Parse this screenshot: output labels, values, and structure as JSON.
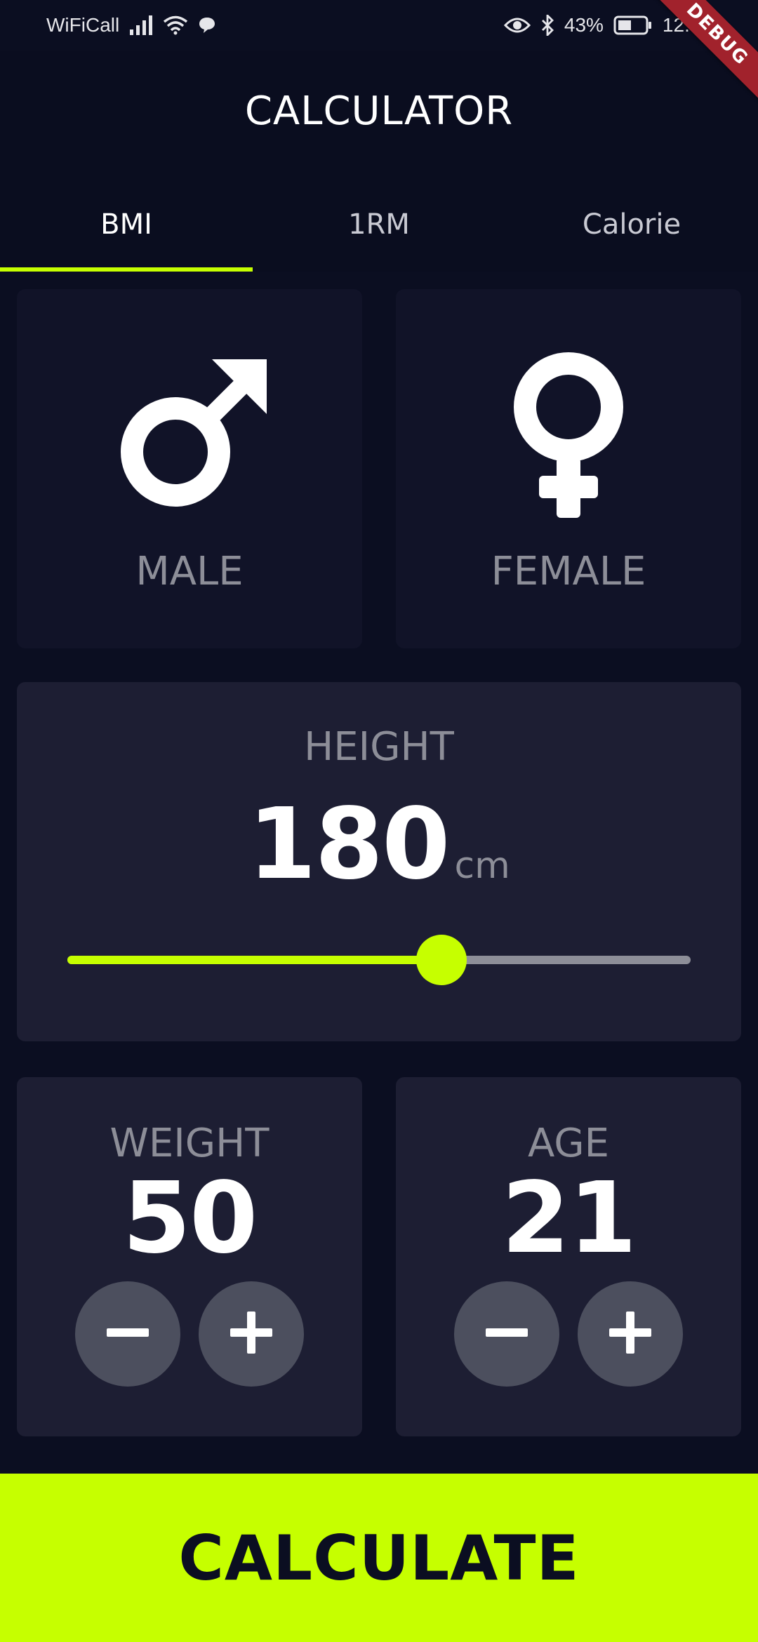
{
  "status_bar": {
    "carrier": "WiFiCall",
    "battery": "43%",
    "time": "12:05",
    "icons": [
      "signal-icon",
      "wifi-icon",
      "chat-bubble-icon",
      "eye-icon",
      "bluetooth-icon",
      "battery-icon"
    ]
  },
  "debug_banner": "DEBUG",
  "app_bar": {
    "title": "CALCULATOR"
  },
  "tabs": [
    {
      "label": "BMI",
      "active": true
    },
    {
      "label": "1RM",
      "active": false
    },
    {
      "label": "Calorie",
      "active": false
    }
  ],
  "gender": {
    "male": {
      "label": "MALE",
      "icon": "male-symbol-icon"
    },
    "female": {
      "label": "FEMALE",
      "icon": "female-symbol-icon"
    }
  },
  "height": {
    "label": "HEIGHT",
    "value": "180",
    "unit": "cm",
    "slider_fraction": 0.6
  },
  "weight": {
    "label": "WEIGHT",
    "value": "50"
  },
  "age": {
    "label": "AGE",
    "value": "21"
  },
  "calculate": {
    "label": "CALCULATE"
  },
  "colors": {
    "background": "#0b0e21",
    "accent": "#c6ff00",
    "active_card": "#1d1e33",
    "inactive_card": "#111328",
    "muted_text": "#8d8e98",
    "round_button": "#4c4f5e",
    "debug_ribbon": "#a1222c"
  }
}
